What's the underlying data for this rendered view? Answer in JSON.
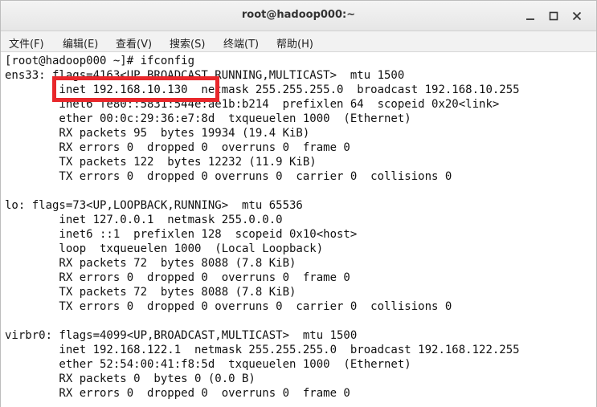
{
  "window": {
    "title": "root@hadoop000:~"
  },
  "menubar": {
    "items": [
      "文件(F)",
      "编辑(E)",
      "查看(V)",
      "搜索(S)",
      "终端(T)",
      "帮助(H)"
    ]
  },
  "terminal": {
    "lines": [
      "[root@hadoop000 ~]# ifconfig",
      "ens33: flags=4163<UP,BROADCAST,RUNNING,MULTICAST>  mtu 1500",
      "        inet 192.168.10.130  netmask 255.255.255.0  broadcast 192.168.10.255",
      "        inet6 fe80::5831:544e:ae1b:b214  prefixlen 64  scopeid 0x20<link>",
      "        ether 00:0c:29:36:e7:8d  txqueuelen 1000  (Ethernet)",
      "        RX packets 95  bytes 19934 (19.4 KiB)",
      "        RX errors 0  dropped 0  overruns 0  frame 0",
      "        TX packets 122  bytes 12232 (11.9 KiB)",
      "        TX errors 0  dropped 0 overruns 0  carrier 0  collisions 0",
      "",
      "lo: flags=73<UP,LOOPBACK,RUNNING>  mtu 65536",
      "        inet 127.0.0.1  netmask 255.0.0.0",
      "        inet6 ::1  prefixlen 128  scopeid 0x10<host>",
      "        loop  txqueuelen 1000  (Local Loopback)",
      "        RX packets 72  bytes 8088 (7.8 KiB)",
      "        RX errors 0  dropped 0  overruns 0  frame 0",
      "        TX packets 72  bytes 8088 (7.8 KiB)",
      "        TX errors 0  dropped 0 overruns 0  carrier 0  collisions 0",
      "",
      "virbr0: flags=4099<UP,BROADCAST,MULTICAST>  mtu 1500",
      "        inet 192.168.122.1  netmask 255.255.255.0  broadcast 192.168.122.255",
      "        ether 52:54:00:41:f8:5d  txqueuelen 1000  (Ethernet)",
      "        RX packets 0  bytes 0 (0.0 B)",
      "        RX errors 0  dropped 0  overruns 0  frame 0"
    ]
  },
  "colors": {
    "highlight_box": "#e8272b",
    "terminal_bg": "#ffffff",
    "terminal_fg": "#111111"
  }
}
